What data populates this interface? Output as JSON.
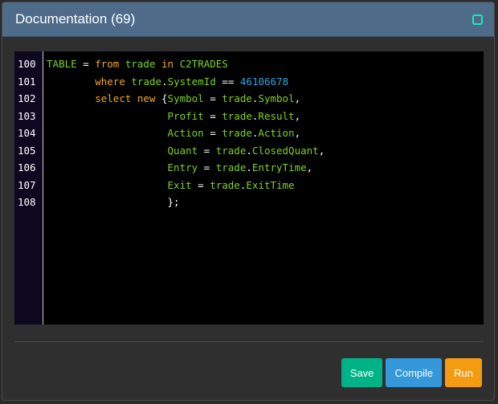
{
  "dialog": {
    "title": "Documentation (69)"
  },
  "editor": {
    "line_numbers": [
      "100",
      "101",
      "102",
      "103",
      "104",
      "105",
      "106",
      "107",
      "108"
    ],
    "lines": [
      [
        {
          "t": "TABLE",
          "c": "id"
        },
        {
          "t": " = ",
          "c": "op"
        },
        {
          "t": "from",
          "c": "kw"
        },
        {
          "t": " ",
          "c": "op"
        },
        {
          "t": "trade",
          "c": "id"
        },
        {
          "t": " ",
          "c": "op"
        },
        {
          "t": "in",
          "c": "kw"
        },
        {
          "t": " ",
          "c": "op"
        },
        {
          "t": "C2TRADES",
          "c": "id"
        }
      ],
      [
        {
          "t": "        ",
          "c": "op"
        },
        {
          "t": "where",
          "c": "kw"
        },
        {
          "t": " ",
          "c": "op"
        },
        {
          "t": "trade",
          "c": "id"
        },
        {
          "t": ".",
          "c": "op"
        },
        {
          "t": "SystemId",
          "c": "id"
        },
        {
          "t": " == ",
          "c": "op"
        },
        {
          "t": "46106678",
          "c": "num"
        }
      ],
      [
        {
          "t": "        ",
          "c": "op"
        },
        {
          "t": "select",
          "c": "kw"
        },
        {
          "t": " ",
          "c": "op"
        },
        {
          "t": "new",
          "c": "kw"
        },
        {
          "t": " {",
          "c": "op"
        },
        {
          "t": "Symbol",
          "c": "id"
        },
        {
          "t": " = ",
          "c": "op"
        },
        {
          "t": "trade",
          "c": "id"
        },
        {
          "t": ".",
          "c": "op"
        },
        {
          "t": "Symbol",
          "c": "id"
        },
        {
          "t": ",",
          "c": "op"
        }
      ],
      [
        {
          "t": "                    ",
          "c": "op"
        },
        {
          "t": "Profit",
          "c": "id"
        },
        {
          "t": " = ",
          "c": "op"
        },
        {
          "t": "trade",
          "c": "id"
        },
        {
          "t": ".",
          "c": "op"
        },
        {
          "t": "Result",
          "c": "id"
        },
        {
          "t": ",",
          "c": "op"
        }
      ],
      [
        {
          "t": "                    ",
          "c": "op"
        },
        {
          "t": "Action",
          "c": "id"
        },
        {
          "t": " = ",
          "c": "op"
        },
        {
          "t": "trade",
          "c": "id"
        },
        {
          "t": ".",
          "c": "op"
        },
        {
          "t": "Action",
          "c": "id"
        },
        {
          "t": ",",
          "c": "op"
        }
      ],
      [
        {
          "t": "                    ",
          "c": "op"
        },
        {
          "t": "Quant",
          "c": "id"
        },
        {
          "t": " = ",
          "c": "op"
        },
        {
          "t": "trade",
          "c": "id"
        },
        {
          "t": ".",
          "c": "op"
        },
        {
          "t": "ClosedQuant",
          "c": "id"
        },
        {
          "t": ",",
          "c": "op"
        }
      ],
      [
        {
          "t": "                    ",
          "c": "op"
        },
        {
          "t": "Entry",
          "c": "id"
        },
        {
          "t": " = ",
          "c": "op"
        },
        {
          "t": "trade",
          "c": "id"
        },
        {
          "t": ".",
          "c": "op"
        },
        {
          "t": "EntryTime",
          "c": "id"
        },
        {
          "t": ",",
          "c": "op"
        }
      ],
      [
        {
          "t": "                    ",
          "c": "op"
        },
        {
          "t": "Exit",
          "c": "id"
        },
        {
          "t": " = ",
          "c": "op"
        },
        {
          "t": "trade",
          "c": "id"
        },
        {
          "t": ".",
          "c": "op"
        },
        {
          "t": "ExitTime",
          "c": "id"
        }
      ],
      [
        {
          "t": "                    ",
          "c": "op"
        },
        {
          "t": "};",
          "c": "op"
        }
      ]
    ]
  },
  "buttons": {
    "save_label": "Save",
    "compile_label": "Compile",
    "run_label": "Run"
  },
  "colors": {
    "header": "#4e6b8a",
    "keyword": "#f5a623",
    "identifier": "#7ed321",
    "number": "#2ea8e6",
    "save": "#00b386",
    "compile": "#3498db",
    "run": "#f39c12"
  },
  "icons": {
    "close": "close-icon"
  }
}
